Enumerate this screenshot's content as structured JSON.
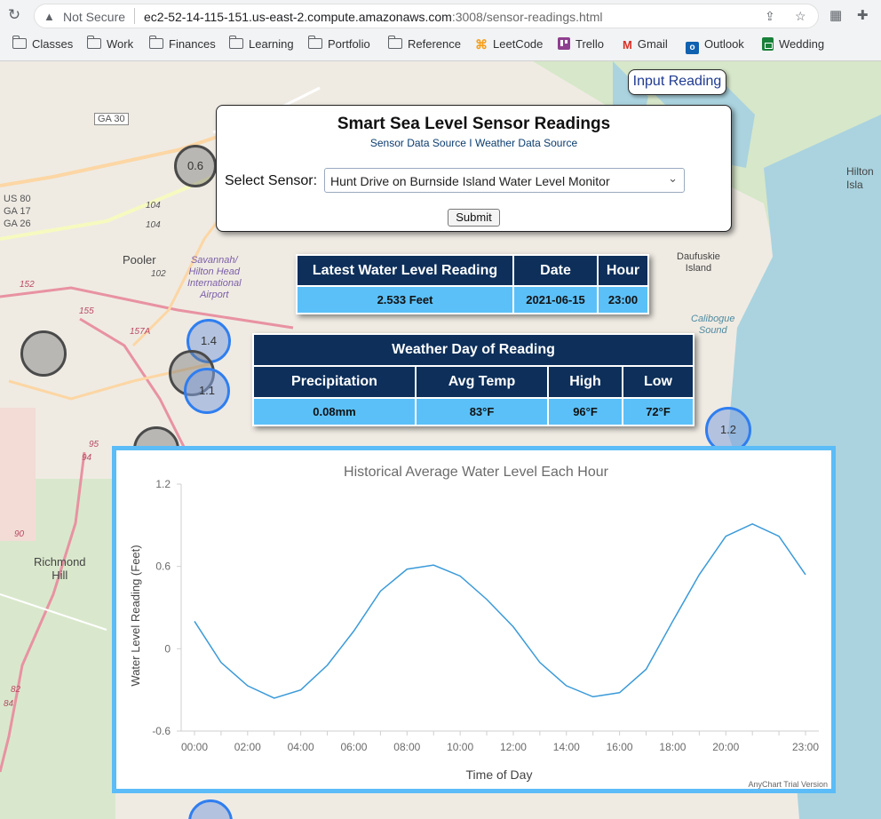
{
  "browser": {
    "security": "Not Secure",
    "url_host": "ec2-52-14-115-151.us-east-2.compute.amazonaws.com",
    "url_rest": ":3008/sensor-readings.html",
    "bookmarks": [
      {
        "label": "Classes",
        "icon": "folder-icon"
      },
      {
        "label": "Work",
        "icon": "folder-icon"
      },
      {
        "label": "Finances",
        "icon": "folder-icon"
      },
      {
        "label": "Learning",
        "icon": "folder-icon"
      },
      {
        "label": "Portfolio",
        "icon": "folder-icon"
      },
      {
        "label": "Reference",
        "icon": "folder-icon"
      },
      {
        "label": "LeetCode",
        "icon": "leetcode-icon"
      },
      {
        "label": "Trello",
        "icon": "trello-icon"
      },
      {
        "label": "Gmail",
        "icon": "gmail-icon"
      },
      {
        "label": "Outlook",
        "icon": "outlook-icon"
      },
      {
        "label": "Wedding",
        "icon": "sheets-icon"
      }
    ]
  },
  "map": {
    "labels": {
      "ga30": "GA 30",
      "us80": "US 80",
      "ga17": "GA 17",
      "ga26": "GA 26",
      "pooler": "Pooler",
      "airport": "Savannah/\nHilton Head\nInternational\nAirport",
      "daufuskie": "Daufuskie\nIsland",
      "calibogue": "Calibogue\nSound",
      "hilton": "Hilton\nIsla",
      "richmond": "Richmond\nHill",
      "r104a": "104",
      "r104b": "104",
      "r102": "102",
      "r152": "152",
      "r155": "155",
      "r157": "157A",
      "r95": "95",
      "r94": "94",
      "r90": "90",
      "r82": "82",
      "r84": "84"
    },
    "markers": [
      "0.6",
      "1.4",
      "1.1",
      "1.2"
    ]
  },
  "panel": {
    "input_reading_label": "Input Reading",
    "title": "Smart Sea Level Sensor Readings",
    "link_sensor": "Sensor Data Source",
    "link_separator": "I",
    "link_weather": "Weather Data Source",
    "select_label": "Select Sensor:",
    "selected_sensor": "Hunt Drive on Burnside Island Water Level Monitor",
    "submit_label": "Submit"
  },
  "latest": {
    "headers": [
      "Latest Water Level Reading",
      "Date",
      "Hour"
    ],
    "values": [
      "2.533 Feet",
      "2021-06-15",
      "23:00"
    ]
  },
  "weather": {
    "title": "Weather Day of Reading",
    "headers": [
      "Precipitation",
      "Avg Temp",
      "High",
      "Low"
    ],
    "values": [
      "0.08mm",
      "83°F",
      "96°F",
      "72°F"
    ]
  },
  "chart_data": {
    "type": "line",
    "title": "Historical Average Water Level Each Hour",
    "xlabel": "Time of Day",
    "ylabel": "Water Level Reading (Feet)",
    "ylim": [
      -0.6,
      1.2
    ],
    "yticks": [
      "1.2",
      "0.6",
      "0",
      "-0.6"
    ],
    "x": [
      "00:00",
      "01:00",
      "02:00",
      "03:00",
      "04:00",
      "05:00",
      "06:00",
      "07:00",
      "08:00",
      "09:00",
      "10:00",
      "11:00",
      "12:00",
      "13:00",
      "14:00",
      "15:00",
      "16:00",
      "17:00",
      "18:00",
      "19:00",
      "20:00",
      "21:00",
      "22:00",
      "23:00"
    ],
    "xtick_labels": [
      "00:00",
      "02:00",
      "04:00",
      "06:00",
      "08:00",
      "10:00",
      "12:00",
      "14:00",
      "16:00",
      "18:00",
      "20:00",
      "23:00"
    ],
    "series": [
      {
        "values": [
          0.2,
          -0.1,
          -0.27,
          -0.36,
          -0.3,
          -0.12,
          0.13,
          0.42,
          0.58,
          0.61,
          0.53,
          0.36,
          0.16,
          -0.1,
          -0.27,
          -0.35,
          -0.32,
          -0.15,
          0.2,
          0.54,
          0.82,
          0.91,
          0.82,
          0.54
        ]
      }
    ],
    "line_color": "#3a9ad9",
    "grid": false,
    "watermark": "AnyChart Trial Version"
  }
}
